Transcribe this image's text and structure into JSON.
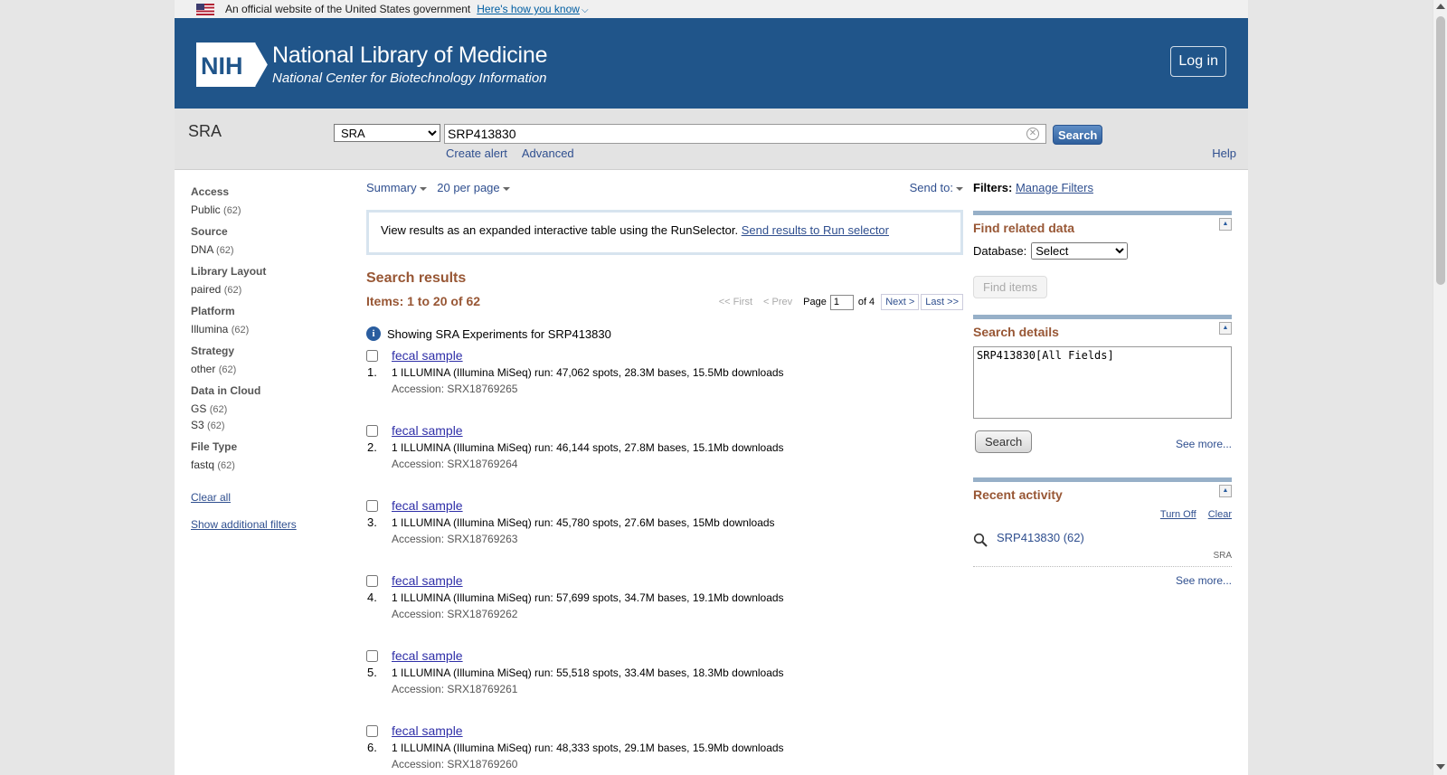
{
  "gov_banner": {
    "text": "An official website of the United States government",
    "link": "Here's how you know"
  },
  "header": {
    "logo_text": "NIH",
    "title": "National Library of Medicine",
    "subtitle": "National Center for Biotechnology Information",
    "login": "Log in"
  },
  "search": {
    "db_label": "SRA",
    "db_selected": "SRA",
    "term": "SRP413830",
    "button": "Search",
    "create_alert": "Create alert",
    "advanced": "Advanced",
    "help": "Help"
  },
  "facets": {
    "groups": [
      {
        "title": "Access",
        "items": [
          {
            "label": "Public",
            "count": "(62)"
          }
        ]
      },
      {
        "title": "Source",
        "items": [
          {
            "label": "DNA",
            "count": "(62)"
          }
        ]
      },
      {
        "title": "Library Layout",
        "items": [
          {
            "label": "paired",
            "count": "(62)"
          }
        ]
      },
      {
        "title": "Platform",
        "items": [
          {
            "label": "Illumina",
            "count": "(62)"
          }
        ]
      },
      {
        "title": "Strategy",
        "items": [
          {
            "label": "other",
            "count": "(62)"
          }
        ]
      },
      {
        "title": "Data in Cloud",
        "items": [
          {
            "label": "GS",
            "count": "(62)"
          },
          {
            "label": "S3",
            "count": "(62)"
          }
        ]
      },
      {
        "title": "File Type",
        "items": [
          {
            "label": "fastq",
            "count": "(62)"
          }
        ]
      }
    ],
    "clear_all": "Clear all",
    "show_additional": "Show additional filters"
  },
  "display": {
    "format": "Summary",
    "per_page": "20 per page",
    "send_to": "Send to:"
  },
  "runselector": {
    "text": "View results as an expanded interactive table using the RunSelector.",
    "link": "Send results to Run selector"
  },
  "results": {
    "title": "Search results",
    "items_label": "Items: 1 to 20 of 62",
    "pager": {
      "first": "<< First",
      "prev": "< Prev",
      "page_label": "Page",
      "page_value": "1",
      "of": "of 4",
      "next": "Next >",
      "last": "Last >>"
    },
    "info": "Showing SRA Experiments for SRP413830",
    "list": [
      {
        "num": "1.",
        "title": "fecal sample",
        "desc": "1 ILLUMINA (Illumina MiSeq) run: 47,062 spots, 28.3M bases, 15.5Mb downloads",
        "accession": "Accession: SRX18769265"
      },
      {
        "num": "2.",
        "title": "fecal sample",
        "desc": "1 ILLUMINA (Illumina MiSeq) run: 46,144 spots, 27.8M bases, 15.1Mb downloads",
        "accession": "Accession: SRX18769264"
      },
      {
        "num": "3.",
        "title": "fecal sample",
        "desc": "1 ILLUMINA (Illumina MiSeq) run: 45,780 spots, 27.6M bases, 15Mb downloads",
        "accession": "Accession: SRX18769263"
      },
      {
        "num": "4.",
        "title": "fecal sample",
        "desc": "1 ILLUMINA (Illumina MiSeq) run: 57,699 spots, 34.7M bases, 19.1Mb downloads",
        "accession": "Accession: SRX18769262"
      },
      {
        "num": "5.",
        "title": "fecal sample",
        "desc": "1 ILLUMINA (Illumina MiSeq) run: 55,518 spots, 33.4M bases, 18.3Mb downloads",
        "accession": "Accession: SRX18769261"
      },
      {
        "num": "6.",
        "title": "fecal sample",
        "desc": "1 ILLUMINA (Illumina MiSeq) run: 48,333 spots, 29.1M bases, 15.9Mb downloads",
        "accession": "Accession: SRX18769260"
      }
    ]
  },
  "sidebar": {
    "filters_label": "Filters:",
    "manage_filters": "Manage Filters",
    "find_related": {
      "title": "Find related data",
      "db_label": "Database:",
      "db_selected": "Select",
      "button": "Find items"
    },
    "search_details": {
      "title": "Search details",
      "query": "SRP413830[All Fields]",
      "button": "Search",
      "see_more": "See more..."
    },
    "recent_activity": {
      "title": "Recent activity",
      "turn_off": "Turn Off",
      "clear": "Clear",
      "item_label": "SRP413830 (62)",
      "item_db": "SRA",
      "see_more": "See more..."
    }
  }
}
